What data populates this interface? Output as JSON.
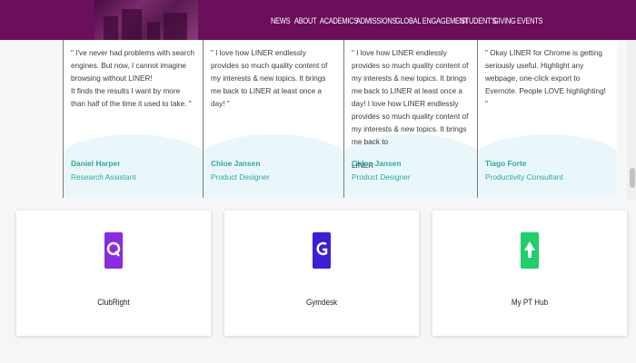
{
  "nav": {
    "items": [
      "NEWS",
      "ABOUT",
      "ACADEMICS",
      "ADMISSIONS",
      "GLOBAL ENGAGEMENT",
      "STUDENT'S",
      "GIVING",
      "EVENTS"
    ]
  },
  "testimonials": [
    {
      "quote": "\" I've never had problems with search engines. But now, I cannot imagine browsing without LINER!\nIt finds the results I want by more than half of the time it used to take. \"",
      "name": "Daniel Harper",
      "role": "Research Assistant"
    },
    {
      "quote": "\" I love how LINER endlessly provides so much quality content of my interests & new topics. It brings me back to LINER at least once a day! \"",
      "name": "Chloe Jansen",
      "role": "Product Designer"
    },
    {
      "quote": "\" I love how LINER endlessly provides so much quality content of my interests & new topics. It brings me back to LINER at least once a day! I love how LINER endlessly provides so much quality content of my interests & new topics. It brings me back to",
      "overflow": "LINER",
      "name": "Chloe Jansen",
      "role": "Product Designer"
    },
    {
      "quote": "\" Okay LINER for Chrome is getting seriously useful. Highlight any webpage, one-click export to Evernote. People LOVE highlighting! \"",
      "name": "Tiago Forte",
      "role": "Productivity Consultant"
    }
  ],
  "apps": [
    {
      "name": "ClubRight",
      "icon": "clubright-q-icon",
      "color": "#8a2be2"
    },
    {
      "name": "Gymdesk",
      "icon": "gymdesk-g-icon",
      "color": "#3a1fd6"
    },
    {
      "name": "My PT Hub",
      "icon": "mypthub-arrow-icon",
      "color": "#1fcf6a"
    }
  ]
}
